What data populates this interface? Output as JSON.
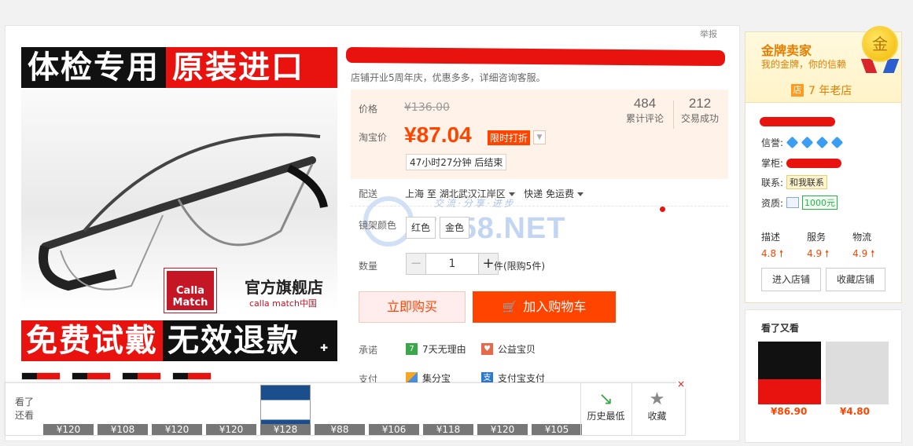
{
  "header": {
    "report_label": "举报"
  },
  "gallery": {
    "banner_top_left": "体检专用",
    "banner_top_right": "原装进口",
    "brand_logo": "Calla Match",
    "brand_title": "官方旗舰店",
    "brand_sub": "calla match中国",
    "banner_bottom_left": "免费试戴",
    "banner_bottom_right": "无效退款"
  },
  "product": {
    "subtitle": "店铺开业5周年庆，优惠多多，详细咨询客服。",
    "price_label": "价格",
    "original_price": "¥136.00",
    "taobao_price_label": "淘宝价",
    "current_price": "¥87.04",
    "promo_badge": "限时打折",
    "countdown": "47小时27分钟 后结束",
    "reviews_count": "484",
    "reviews_label": "累计评论",
    "sales_count": "212",
    "sales_label": "交易成功"
  },
  "delivery": {
    "label": "配送",
    "from": "上海",
    "to_word": "至",
    "destination": "湖北武汉江岸区",
    "shipping": "快递 免运费"
  },
  "frame_color": {
    "label": "镜架颜色",
    "options": [
      "红色",
      "金色"
    ]
  },
  "quantity": {
    "label": "数量",
    "value": "1",
    "minus": "−",
    "plus": "+",
    "note": "件(限购5件)"
  },
  "actions": {
    "buy_now": "立即购买",
    "add_to_cart": "加入购物车"
  },
  "promise": {
    "label": "承诺",
    "items": [
      "7天无理由",
      "公益宝贝"
    ]
  },
  "payment": {
    "label": "支付",
    "items": [
      "集分宝",
      "支付宝支付"
    ]
  },
  "watermark": {
    "slogan": "交流·分享·进步",
    "site": "TB58.NET"
  },
  "seller": {
    "tier": "金牌卖家",
    "tier_sub": "我的金牌，你的信赖",
    "badge": "金",
    "shop_age_icon": "店",
    "shop_age": "7 年老店",
    "credit_label": "信誉:",
    "manager_label": "掌柜:",
    "contact_label": "联系:",
    "contact_button": "和我联系",
    "qualification_label": "资质:",
    "deposit": "1000元",
    "ratings": [
      {
        "label": "描述",
        "value": "4.8"
      },
      {
        "label": "服务",
        "value": "4.9"
      },
      {
        "label": "物流",
        "value": "4.9"
      }
    ],
    "enter_shop": "进入店铺",
    "favorite_shop": "收藏店铺"
  },
  "also_viewed": {
    "title": "看了又看",
    "items": [
      {
        "price": "¥86.90"
      },
      {
        "price": "¥4.80"
      }
    ]
  },
  "bottom_bar": {
    "label": "看了还看",
    "prices": [
      "¥120",
      "¥108",
      "¥120",
      "¥120",
      "¥128",
      "¥88",
      "¥106",
      "¥118",
      "¥120",
      "¥105"
    ],
    "history_low": "历史最低",
    "favorite": "收藏",
    "close": "×"
  },
  "colors": {
    "accent": "#ff4400",
    "promo_bg": "#fff2e8",
    "gold": "#e67e00"
  }
}
